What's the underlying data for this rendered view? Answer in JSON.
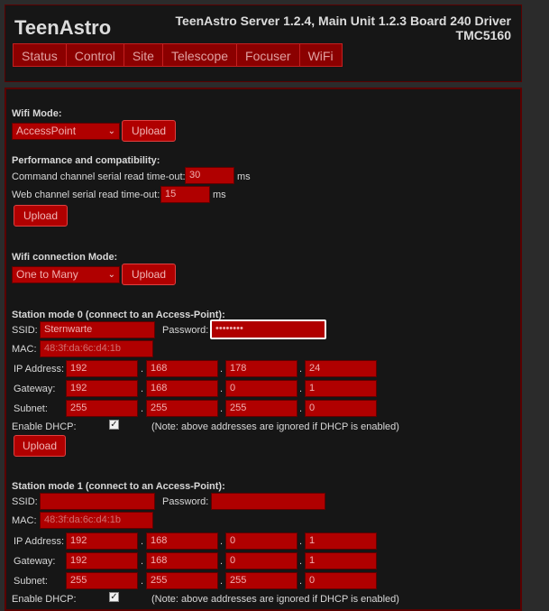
{
  "header": {
    "brand": "TeenAstro",
    "version_line1": "TeenAstro Server 1.2.4, Main Unit 1.2.3 Board 240 Driver",
    "version_line2": "TMC5160",
    "tabs": [
      "Status",
      "Control",
      "Site",
      "Telescope",
      "Focuser",
      "WiFi"
    ]
  },
  "wifi_mode": {
    "label": "Wifi Mode:",
    "value": "AccessPoint",
    "upload": "Upload"
  },
  "performance": {
    "title": "Performance and compatibility:",
    "cmd_label": "Command channel serial read time-out:",
    "cmd_value": "30",
    "cmd_unit": "ms",
    "web_label": "Web channel serial read time-out:",
    "web_value": "15",
    "web_unit": "ms",
    "upload": "Upload"
  },
  "wifi_conn": {
    "label": "Wifi connection Mode:",
    "value": "One to Many",
    "upload": "Upload"
  },
  "station0": {
    "title": "Station mode 0 (connect to an Access-Point):",
    "ssid_label": "SSID:",
    "ssid": "Sternwarte",
    "password_label": "Password:",
    "password": "••••••••",
    "mac_label": "MAC:",
    "mac": "48:3f:da:6c:d4:1b",
    "ip_label": "IP Address:",
    "ip": [
      "192",
      "168",
      "178",
      "24"
    ],
    "gw_label": "Gateway:",
    "gw": [
      "192",
      "168",
      "0",
      "1"
    ],
    "subnet_label": "Subnet:",
    "subnet": [
      "255",
      "255",
      "255",
      "0"
    ],
    "dhcp_label": "Enable DHCP:",
    "dhcp_note": "(Note: above addresses are ignored if DHCP is enabled)",
    "upload": "Upload"
  },
  "station1": {
    "title": "Station mode 1 (connect to an Access-Point):",
    "ssid_label": "SSID:",
    "ssid": "",
    "password_label": "Password:",
    "password": "",
    "mac_label": "MAC:",
    "mac": "48:3f:da:6c:d4:1b",
    "ip_label": "IP Address:",
    "ip": [
      "192",
      "168",
      "0",
      "1"
    ],
    "gw_label": "Gateway:",
    "gw": [
      "192",
      "168",
      "0",
      "1"
    ],
    "subnet_label": "Subnet:",
    "subnet": [
      "255",
      "255",
      "255",
      "0"
    ],
    "dhcp_label": "Enable DHCP:",
    "dhcp_note": "(Note: above addresses are ignored if DHCP is enabled)"
  },
  "colors": {
    "accent": "#b00000",
    "border": "#5a0000",
    "panel": "#161616",
    "background": "#2b2b2b"
  }
}
